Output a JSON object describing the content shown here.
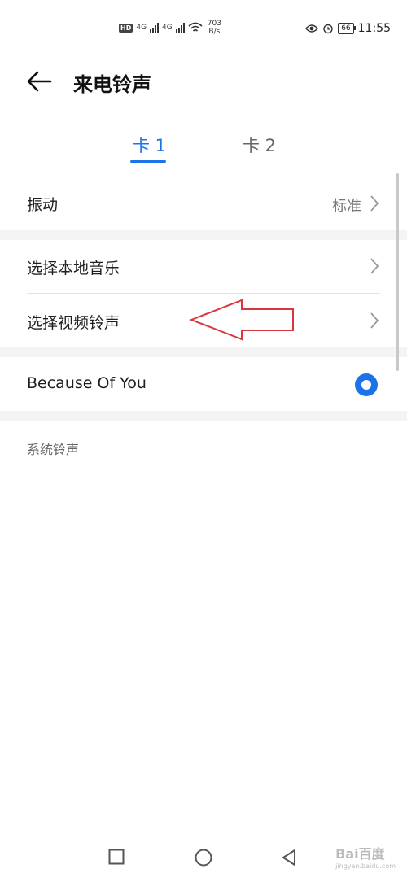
{
  "status_bar": {
    "hd": "HD",
    "signal_1": "4G",
    "signal_2": "4G",
    "speed_value": "703",
    "speed_unit": "B/s",
    "battery": "66",
    "time": "11:55"
  },
  "header": {
    "title": "来电铃声"
  },
  "tabs": [
    {
      "label": "卡 1",
      "selected": true
    },
    {
      "label": "卡 2",
      "selected": false
    }
  ],
  "rows": {
    "vibration": {
      "label": "振动",
      "value": "标准"
    },
    "local_music": {
      "label": "选择本地音乐"
    },
    "video_ringtone": {
      "label": "选择视频铃声"
    },
    "current_ringtone": {
      "label": "Because Of You",
      "selected": true
    }
  },
  "section": {
    "system_ringtones": "系统铃声"
  },
  "watermark": {
    "text": "Bai百度",
    "subtext": "jingyan.baidu.com"
  },
  "colors": {
    "accent": "#1a73e8",
    "annotation": "#d9363e"
  }
}
